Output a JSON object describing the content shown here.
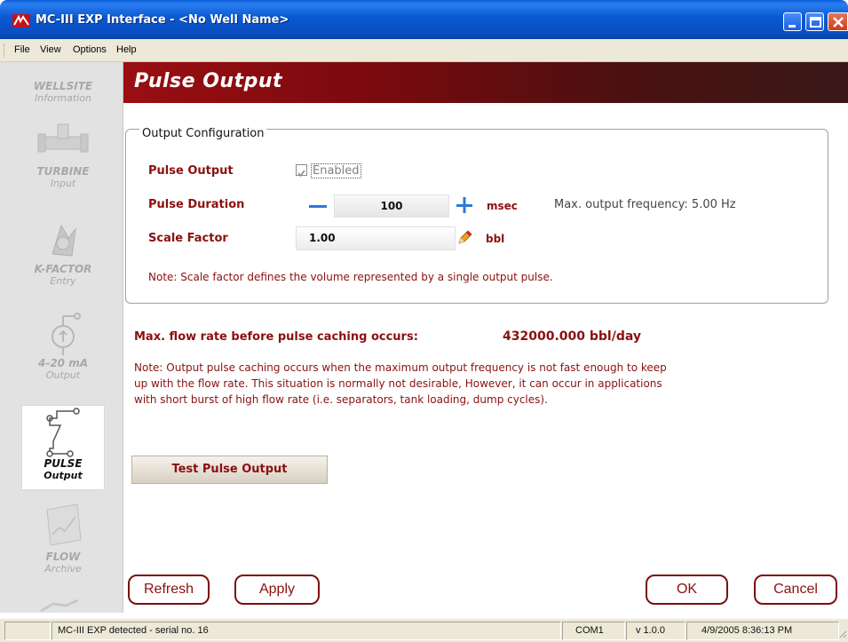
{
  "window": {
    "title": "MC-III EXP Interface - <No Well Name>"
  },
  "menu": {
    "items": [
      {
        "label": "File"
      },
      {
        "label": "View"
      },
      {
        "label": "Options"
      },
      {
        "label": "Help"
      }
    ]
  },
  "sidebar": {
    "items": [
      {
        "line1": "WELLSITE",
        "line2": "Information",
        "icon": "wellsite-icon",
        "active": false
      },
      {
        "line1": "TURBINE",
        "line2": "Input",
        "icon": "turbine-icon",
        "active": false
      },
      {
        "line1": "K-FACTOR",
        "line2": "Entry",
        "icon": "k-factor-icon",
        "active": false
      },
      {
        "line1": "4-20 mA",
        "line2": "Output",
        "icon": "analog-output-icon",
        "active": false
      },
      {
        "line1": "PULSE",
        "line2": "Output",
        "icon": "pulse-icon",
        "active": true
      },
      {
        "line1": "FLOW",
        "line2": "Archive",
        "icon": "flow-archive-icon",
        "active": false
      }
    ]
  },
  "header": {
    "title": "Pulse Output"
  },
  "config": {
    "legend": "Output Configuration",
    "pulse_output_label": "Pulse Output",
    "enabled_label": "Enabled",
    "enabled_checked": true,
    "pulse_duration_label": "Pulse Duration",
    "pulse_duration_value": "100",
    "pulse_duration_unit": "msec",
    "max_freq_text": "Max. output frequency: 5.00 Hz",
    "scale_factor_label": "Scale Factor",
    "scale_factor_value": "1.00",
    "scale_factor_unit": "bbl",
    "note": "Note: Scale factor defines the volume represented by a single output pulse."
  },
  "flow": {
    "max_flow_label": "Max. flow rate before pulse caching occurs:",
    "max_flow_value": "432000.000 bbl/day",
    "note_line1": "Note: Output pulse caching occurs when the maximum output frequency is not fast enough to keep",
    "note_line2": "up with the flow rate. This situation is normally not desirable, However, it can occur in applications",
    "note_line3": "with short burst of high flow rate (i.e. separators, tank loading, dump cycles)."
  },
  "buttons": {
    "test_pulse": "Test Pulse Output",
    "refresh": "Refresh",
    "apply": "Apply",
    "ok": "OK",
    "cancel": "Cancel"
  },
  "status": {
    "message": "MC-III EXP detected - serial no. 16",
    "port": "COM1",
    "version": "v 1.0.0",
    "datetime": "4/9/2005 8:36:13 PM"
  },
  "colors": {
    "accent": "#8b1010",
    "header_bg": "#7a0a0e",
    "titlebar": "#0a58d0",
    "stepper": "#2a7ad8"
  }
}
